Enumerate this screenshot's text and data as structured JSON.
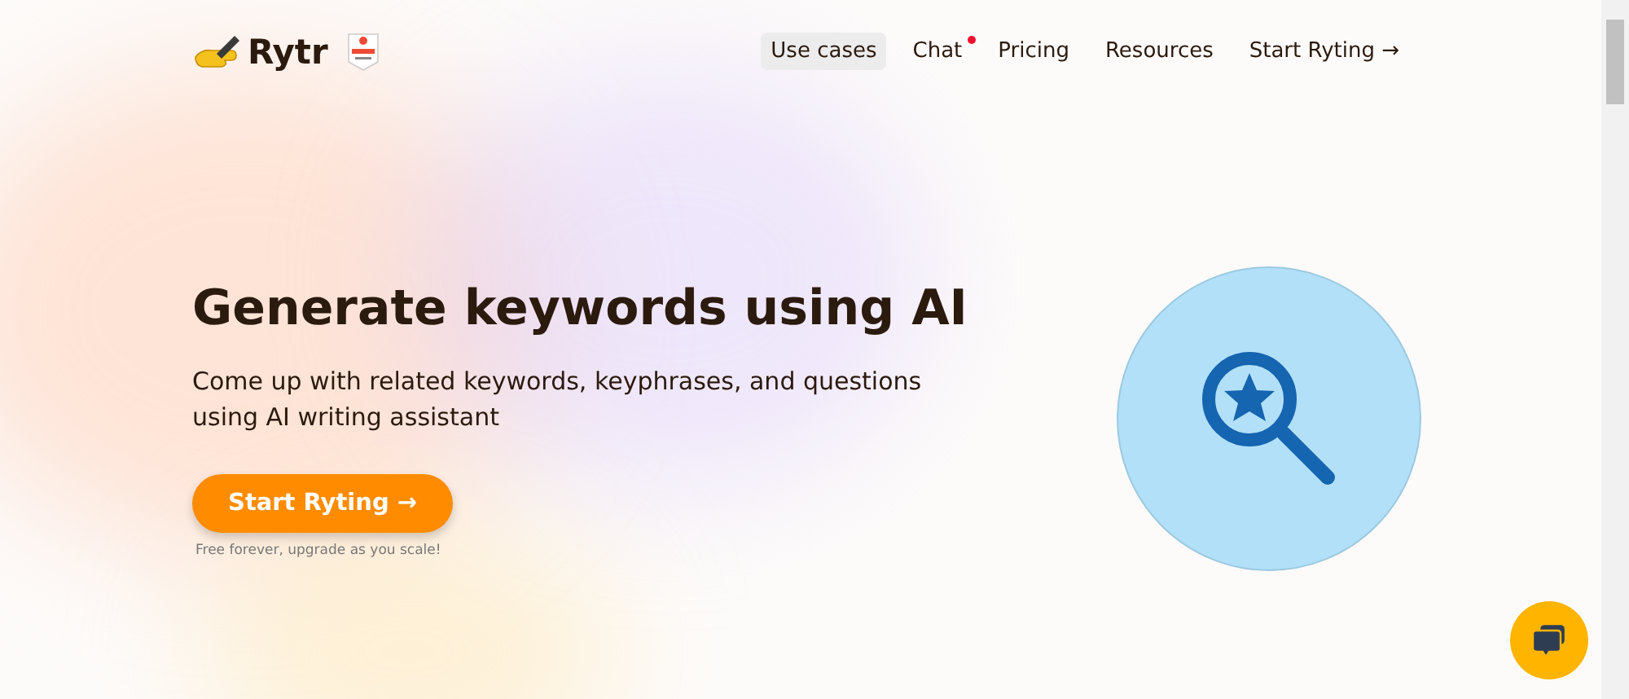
{
  "header": {
    "logo": "Rytr",
    "nav": [
      {
        "label": "Use cases",
        "selected": true,
        "notification": false
      },
      {
        "label": "Chat",
        "selected": false,
        "notification": true
      },
      {
        "label": "Pricing",
        "selected": false,
        "notification": false
      },
      {
        "label": "Resources",
        "selected": false,
        "notification": false
      },
      {
        "label": "Start Ryting →",
        "selected": false,
        "notification": false
      }
    ]
  },
  "hero": {
    "title": "Generate keywords using AI",
    "subtitle": "Come up with related keywords, keyphrases, and questions using AI writing assistant",
    "cta": "Start Ryting →",
    "note": "Free forever, upgrade as you scale!"
  }
}
